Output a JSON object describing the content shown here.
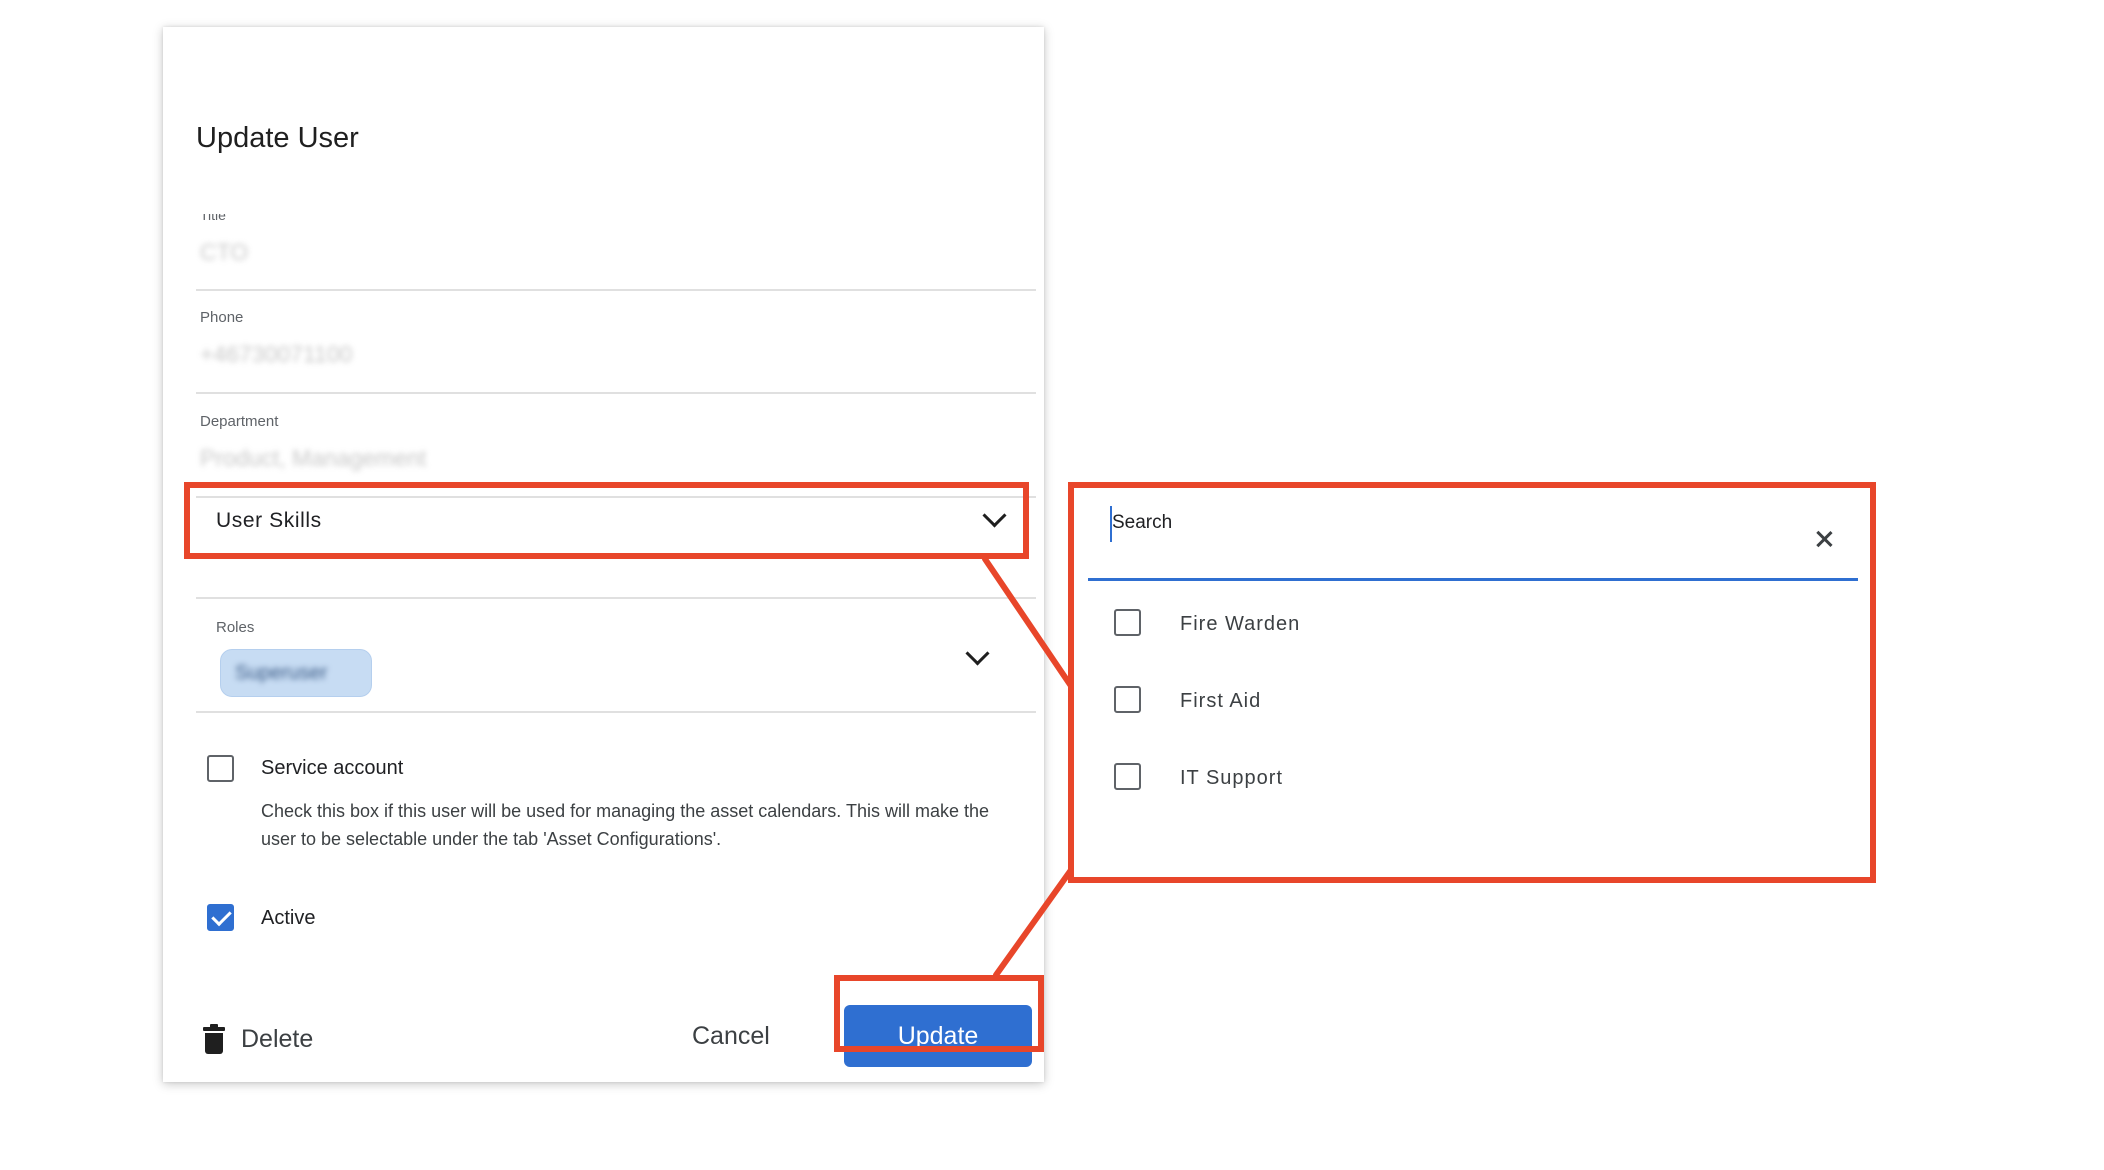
{
  "dialog": {
    "title": "Update User",
    "fields": {
      "title": {
        "label": "Title",
        "value": "CTO"
      },
      "phone": {
        "label": "Phone",
        "value": "+46730071100"
      },
      "department": {
        "label": "Department",
        "value": "Product, Management"
      }
    },
    "user_skills": {
      "label": "User Skills"
    },
    "roles": {
      "label": "Roles",
      "chip": "Superuser"
    },
    "service_account": {
      "label": "Service account",
      "checked": false,
      "help": "Check this box if this user will be used for managing the asset calendars. This will make the user to be selectable under the tab 'Asset Configurations'."
    },
    "active": {
      "label": "Active",
      "checked": true
    },
    "actions": {
      "delete": "Delete",
      "cancel": "Cancel",
      "update": "Update"
    }
  },
  "skills_panel": {
    "search_placeholder": "Search",
    "options": [
      {
        "label": "Fire Warden",
        "checked": false
      },
      {
        "label": "First Aid",
        "checked": false
      },
      {
        "label": "IT Support",
        "checked": false
      }
    ]
  },
  "colors": {
    "highlight": "#e8462a",
    "primary": "#2f6fd1"
  }
}
